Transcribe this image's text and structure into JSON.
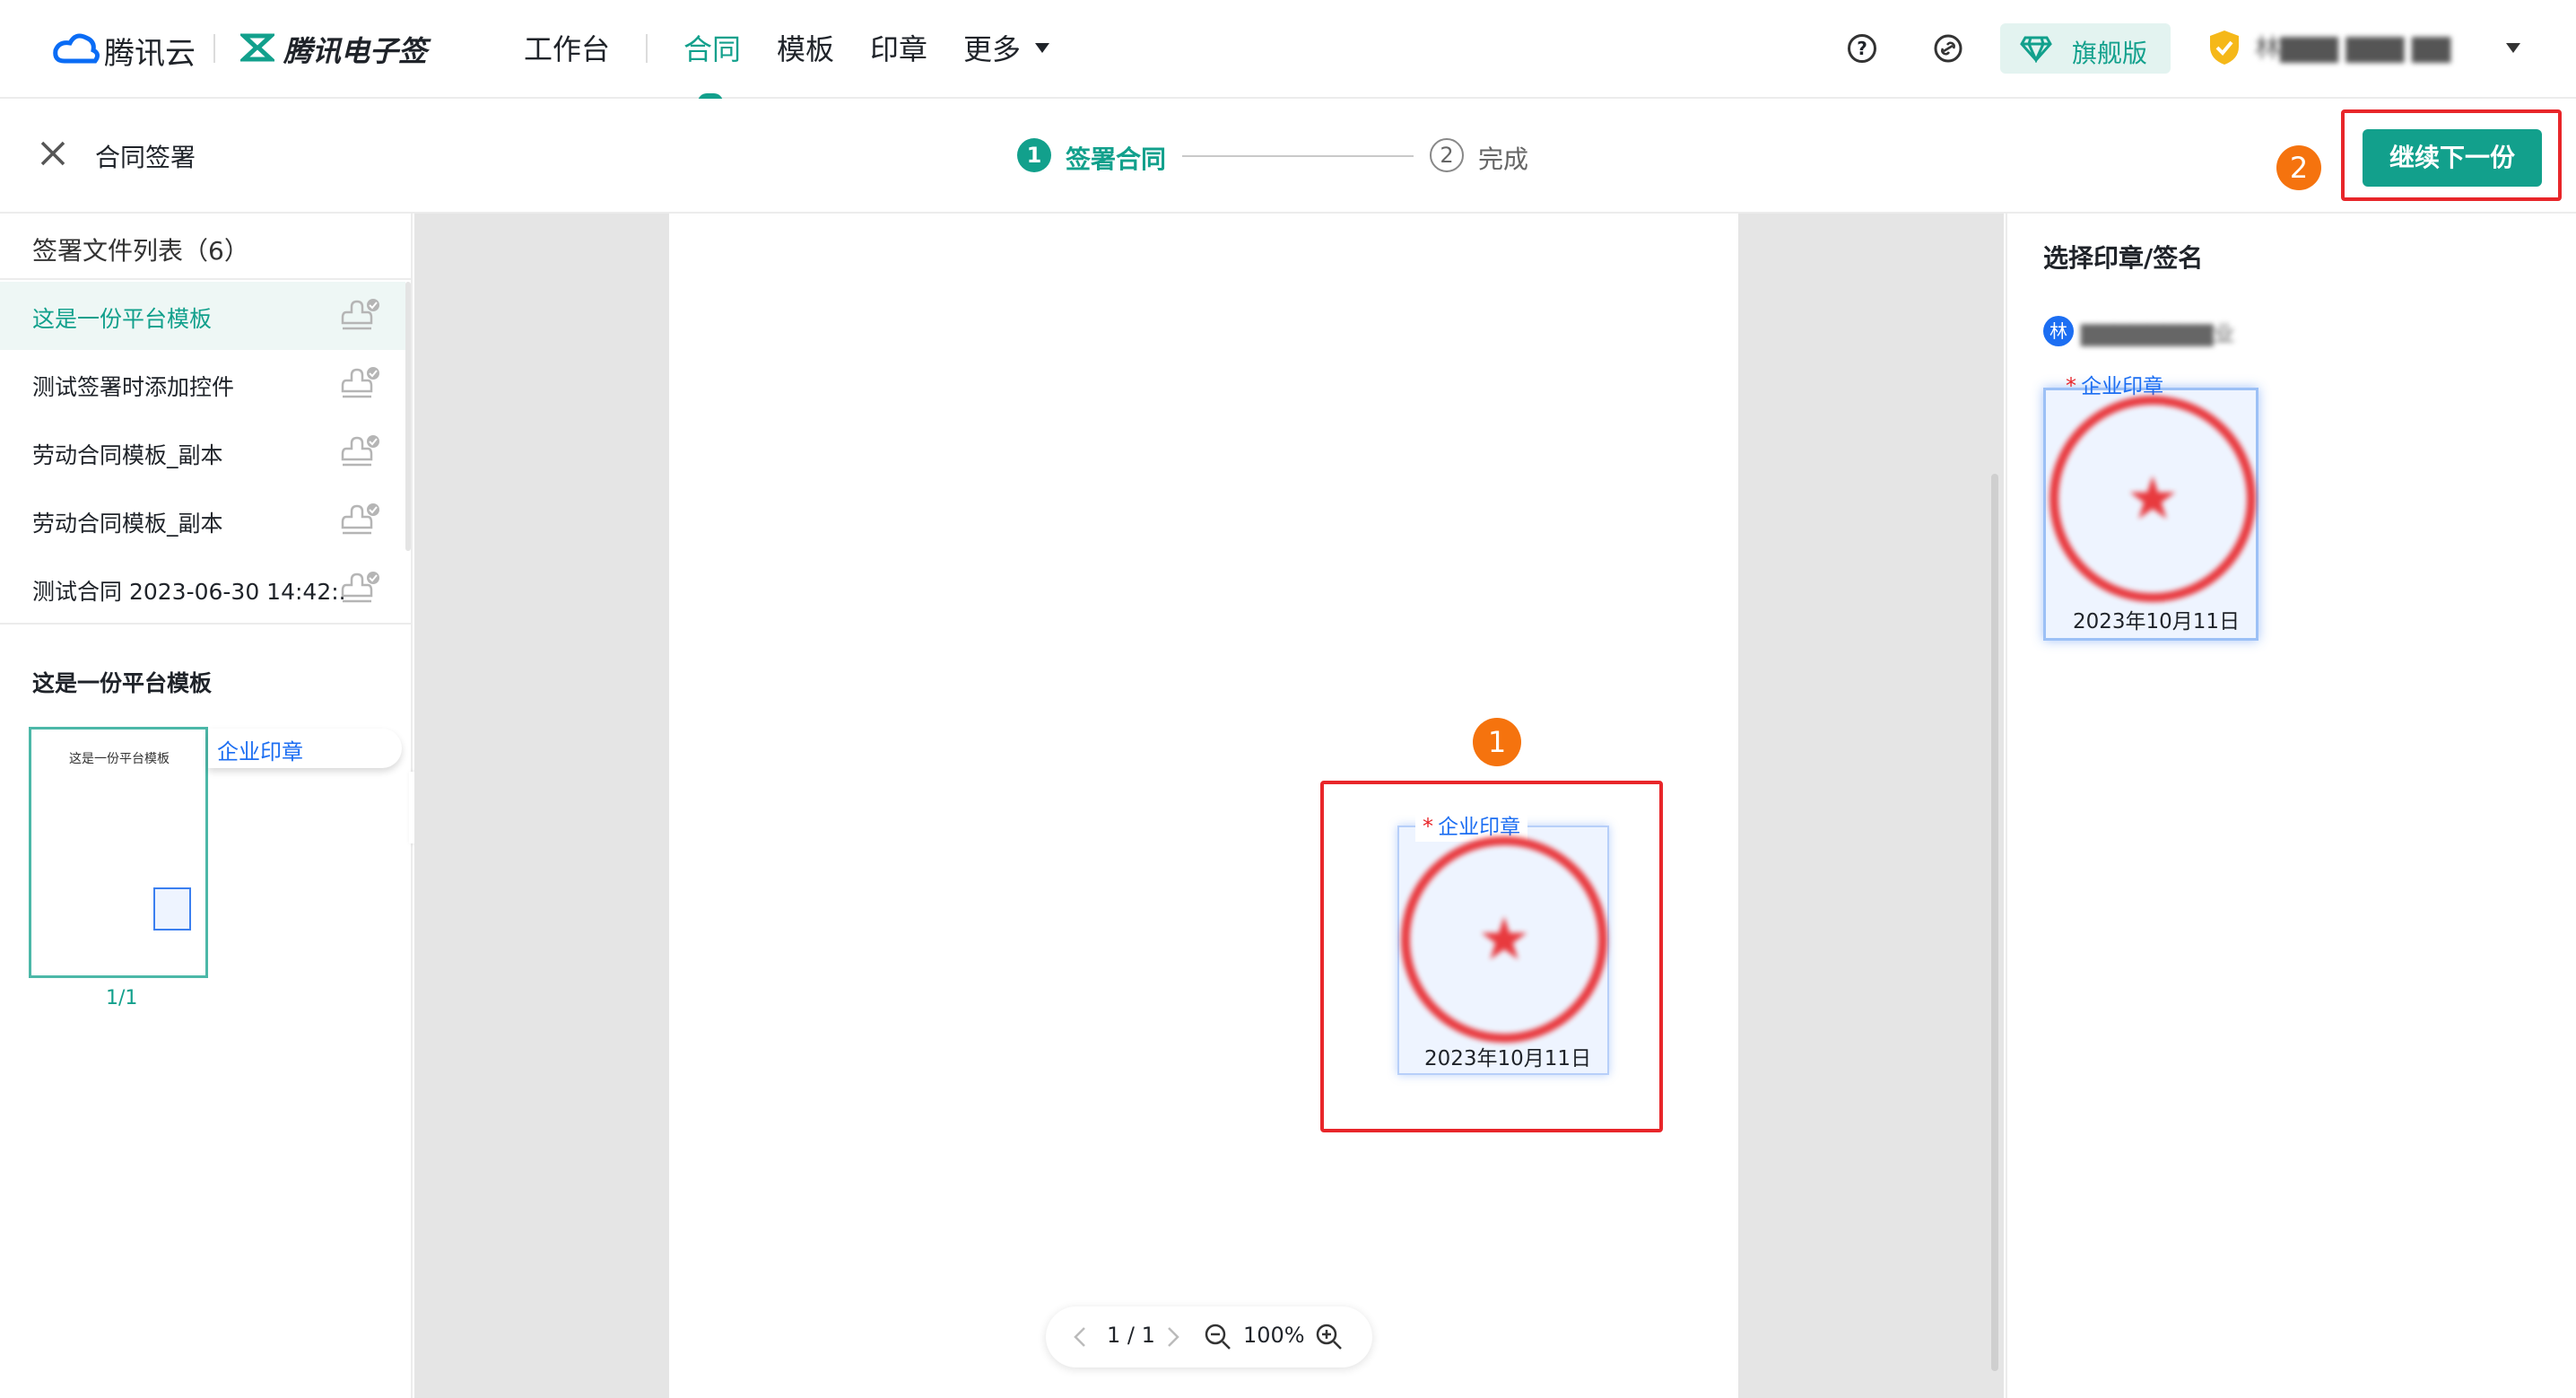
{
  "topnav": {
    "brand_cloud": "腾讯云",
    "brand_esign": "腾讯电子签",
    "nav": [
      "工作台",
      "合同",
      "模板",
      "印章",
      "更多"
    ],
    "edition_label": "旗舰版",
    "user_name": "林▇▇▇ ▇▇▇ ▇▇",
    "icons": [
      "help-icon",
      "link-icon",
      "diamond-icon",
      "shield-icon",
      "chevron-down-icon"
    ],
    "accent_color": "#12a08c"
  },
  "subheader": {
    "title": "合同签署",
    "step1_num": "1",
    "step1_label": "签署合同",
    "step2_num": "2",
    "step2_label": "完成",
    "next_button": "继续下一份",
    "callout_2": "2"
  },
  "left": {
    "list_title": "签署文件列表（6）",
    "files": [
      "这是一份平台模板",
      "测试签署时添加控件",
      "劳动合同模板_副本",
      "劳动合同模板_副本",
      "测试合同 2023-06-30 14:42:..."
    ],
    "current_doc_title": "这是一份平台模板",
    "thumb_text": "这是一份平台模板",
    "thumb_tag": "企业印章",
    "page_count": "1/1"
  },
  "canvas": {
    "callout_1": "1",
    "seal_label": "企业印章",
    "seal_date": "2023年10月11日",
    "pager": "1 / 1",
    "zoom": "100%"
  },
  "right": {
    "title": "选择印章/签名",
    "org_avatar": "林",
    "org_name": "▇▇▇▇▇▇▇▇业",
    "seal_label": "企业印章",
    "seal_date": "2023年10月11日"
  }
}
